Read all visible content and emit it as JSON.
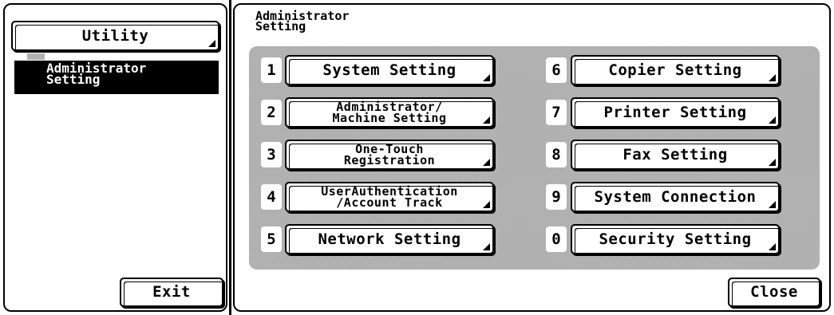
{
  "left": {
    "utility_label": "Utility",
    "admin_item": {
      "line1": "Administrator",
      "line2": "Setting"
    },
    "exit_label": "Exit"
  },
  "right": {
    "title": {
      "line1": "Administrator",
      "line2": "Setting"
    },
    "items": [
      {
        "num": "1",
        "lines": [
          "System Setting"
        ]
      },
      {
        "num": "2",
        "lines": [
          "Administrator/",
          "Machine Setting"
        ]
      },
      {
        "num": "3",
        "lines": [
          "One-Touch",
          "Registration"
        ]
      },
      {
        "num": "4",
        "lines": [
          "UserAuthentication",
          "/Account Track"
        ]
      },
      {
        "num": "5",
        "lines": [
          "Network Setting"
        ]
      },
      {
        "num": "6",
        "lines": [
          "Copier Setting"
        ]
      },
      {
        "num": "7",
        "lines": [
          "Printer Setting"
        ]
      },
      {
        "num": "8",
        "lines": [
          "Fax Setting"
        ]
      },
      {
        "num": "9",
        "lines": [
          "System Connection"
        ]
      },
      {
        "num": "0",
        "lines": [
          "Security Setting"
        ]
      }
    ],
    "close_label": "Close"
  }
}
